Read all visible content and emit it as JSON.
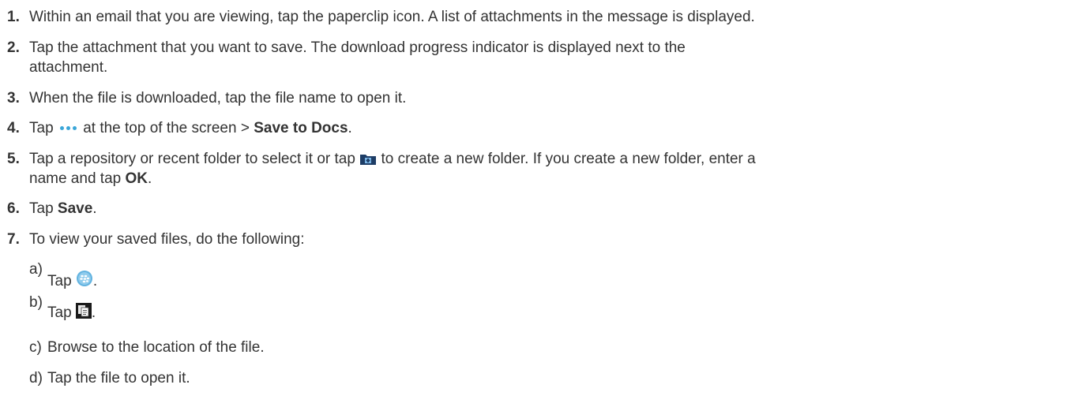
{
  "steps": [
    {
      "n": "1.",
      "text": "Within an email that you are viewing, tap the paperclip icon. A list of attachments in the message is displayed."
    },
    {
      "n": "2.",
      "text": "Tap the attachment that you want to save. The download progress indicator is displayed next to the",
      "line2": "attachment."
    },
    {
      "n": "3.",
      "text": "When the file is downloaded, tap the file name to open it."
    },
    {
      "n": "4.",
      "pre": "Tap",
      "mid": "at the top of the screen >",
      "bold": "Save to Docs",
      "post": "."
    },
    {
      "n": "5.",
      "pre": "Tap a repository or recent folder to select it or tap",
      "post": "to create a new folder. If you create a new folder, enter a",
      "line2pre": "name and tap",
      "line2bold": "OK",
      "line2post": "."
    },
    {
      "n": "6.",
      "pre": "Tap",
      "bold": "Save",
      "post": "."
    },
    {
      "n": "7.",
      "text": "To view your saved files, do the following:"
    }
  ],
  "substeps": [
    {
      "l": "a)",
      "text": "Tap",
      "post": "."
    },
    {
      "l": "b)",
      "text": "Tap",
      "post": "."
    },
    {
      "l": "c)",
      "text": "Browse to the location of the file."
    },
    {
      "l": "d)",
      "text": "Tap the file to open it."
    }
  ],
  "icons": [
    "more-dots-icon",
    "new-folder-icon",
    "blackberry-icon",
    "docs-icon"
  ]
}
